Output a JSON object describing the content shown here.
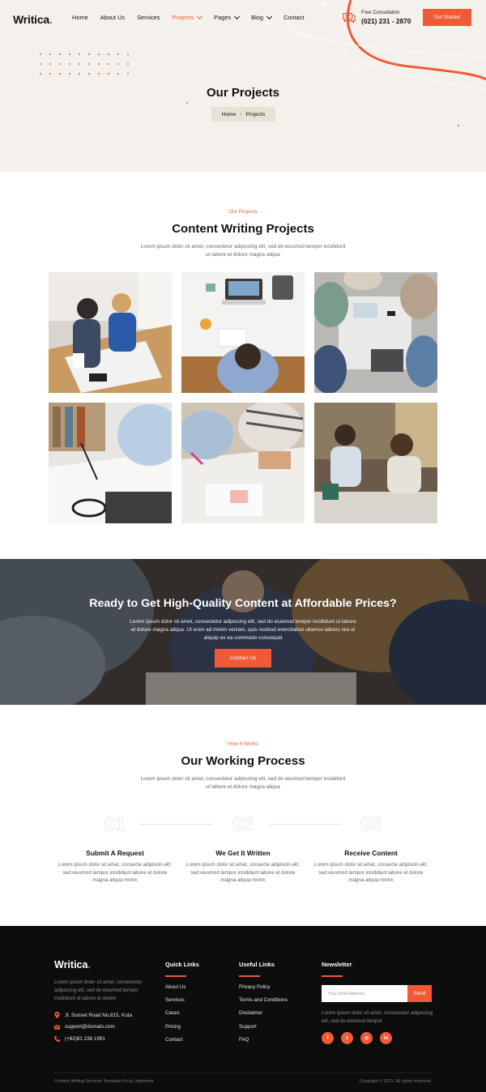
{
  "brand": {
    "name": "Writica",
    "dot": ".",
    "accent": "#f05a36"
  },
  "nav": {
    "items": [
      {
        "label": "Home"
      },
      {
        "label": "About Us"
      },
      {
        "label": "Services"
      },
      {
        "label": "Projects"
      },
      {
        "label": "Pages"
      },
      {
        "label": "Blog"
      },
      {
        "label": "Contact"
      }
    ],
    "active": "Projects"
  },
  "header": {
    "consult_label": "Free Consultation",
    "consult_phone": "(021) 231 - 2870",
    "consult_icon": "chat-icon",
    "cta_label": "Get Started"
  },
  "hero": {
    "title": "Our Projects",
    "breadcrumb": {
      "home": "Home",
      "current": "Projects"
    }
  },
  "projects": {
    "eyebrow": "Our Projects",
    "title": "Content Writing Projects",
    "description": "Lorem ipsum dolor sit amet, consectetur adipiscing elit, sed do eiusmod tempor incididunt ut labore et dolore magna aliqua",
    "images": [
      "two women reviewing papers at a desk",
      "top-down view of person working on laptop with notebook",
      "top-down view of team meeting with laptops",
      "hand writing notes next to glasses and laptop",
      "people working on papers with highlighter",
      "group of colleagues discussing at a table"
    ]
  },
  "cta": {
    "title": "Ready to Get High-Quality Content at Affordable Prices?",
    "description": "Lorem ipsum dolor sit amet, consectetur adipiscing elit, sed do eiusmod tempor incididunt ut labore et dolore magna aliqua. Ut enim ad minim veniam, quis nostrud exercitation ullamco laboris nisi ut aliquip ex ea commodo consequat",
    "button": "Contact Us"
  },
  "process": {
    "eyebrow": "How It Works",
    "title": "Our Working Process",
    "description": "Lorem ipsum dolor sit amet, consectetur adipiscing elit, sed do eiusmod tempor incididunt ut labore et dolore magna aliqua",
    "steps": [
      {
        "num": "01",
        "title": "Submit A Request",
        "desc": "Lorem ipsum dolor sit amet, consecte adipiscin elit, sed eiusmod tempor incididunt labore et dolore magna aliqua minim"
      },
      {
        "num": "02",
        "title": "We Get It Written",
        "desc": "Lorem ipsum dolor sit amet, consecte adipiscin elit, sed eiusmod tempor incididunt labore et dolore magna aliqua minim"
      },
      {
        "num": "03",
        "title": "Receive Content",
        "desc": "Lorem ipsum dolor sit amet, consecte adipiscin elit, sed eiusmod tempor incididunt labore et dolore magna aliqua minim"
      }
    ]
  },
  "footer": {
    "about": "Lorem ipsum dolor sit amet, consectetur adipiscing elit, sed do eiusmod tempor incididunt ut labore et dolore",
    "address": "Jl. Sunset Road No.815, Kuta",
    "email": "support@domain.com",
    "phone": "(+62)81 238 1991",
    "quick_links": {
      "title": "Quick Links",
      "items": [
        "About Us",
        "Services",
        "Cases",
        "Pricing",
        "Contact"
      ]
    },
    "useful_links": {
      "title": "Useful Links",
      "items": [
        "Privacy Policy",
        "Terms and Conditions",
        "Disclaimer",
        "Support",
        "FAQ"
      ]
    },
    "newsletter": {
      "title": "Newsletter",
      "placeholder": "Your Email Address",
      "button": "Send",
      "description": "Lorem ipsum dolor sit amet, consectetur adipiscing elit, sed do eiusmod tempor"
    },
    "socials": [
      {
        "icon": "facebook-icon",
        "glyph": "f"
      },
      {
        "icon": "twitter-icon",
        "glyph": "t"
      },
      {
        "icon": "instagram-icon",
        "glyph": "◎"
      },
      {
        "icon": "linkedin-icon",
        "glyph": "in"
      }
    ],
    "credit": "Content Writing Services Template Kit by Jegtheme",
    "copyright": "Copyright © 2021. All rights reserved."
  }
}
